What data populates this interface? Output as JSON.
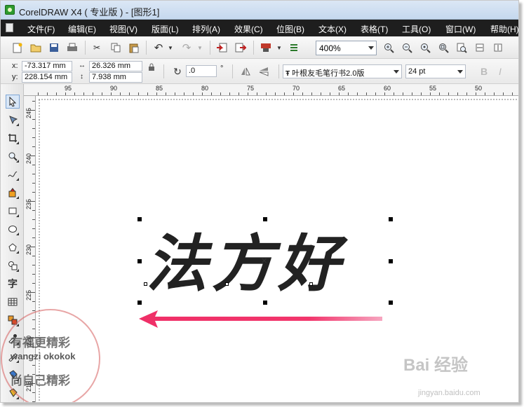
{
  "window": {
    "title": "CorelDRAW X4 ( 专业版 ) - [图形1]"
  },
  "menu": [
    "文件(F)",
    "编辑(E)",
    "视图(V)",
    "版面(L)",
    "排列(A)",
    "效果(C)",
    "位图(B)",
    "文本(X)",
    "表格(T)",
    "工具(O)",
    "窗口(W)",
    "帮助(H)"
  ],
  "toolbar": {
    "zoom_value": "400%",
    "icons": [
      "new-icon",
      "open-icon",
      "save-icon",
      "print-icon",
      "cut-icon",
      "copy-icon",
      "paste-icon",
      "undo-icon",
      "redo-icon",
      "import-icon",
      "export-icon",
      "application-launcher-icon",
      "welcome-screen-icon",
      "zoom-in-icon",
      "zoom-out-icon",
      "zoom-selected-icon",
      "zoom-all-icon",
      "zoom-page-icon",
      "zoom-width-icon",
      "zoom-height-icon"
    ]
  },
  "property_bar": {
    "x_label": "x:",
    "x_value": "-73.317 mm",
    "y_label": "y:",
    "y_value": "228.154 mm",
    "width_value": "26.326 mm",
    "height_value": "7.938 mm",
    "rotation_value": ".0",
    "degree_symbol": "°",
    "font_name": "叶根友毛笔行书2.0版",
    "font_size": "24 pt",
    "bold_label": "B",
    "italic_label": "I"
  },
  "ruler": {
    "horizontal_labels": [
      "95",
      "90",
      "85",
      "80",
      "75",
      "70",
      "65",
      "60",
      "55",
      "50"
    ],
    "vertical_labels": [
      "245",
      "240",
      "235",
      "230",
      "225",
      "220",
      "215"
    ]
  },
  "toolbox": {
    "tools": [
      "pick-tool",
      "shape-tool",
      "crop-tool",
      "zoom-tool",
      "freehand-tool",
      "smart-fill-tool",
      "rectangle-tool",
      "ellipse-tool",
      "polygon-tool",
      "basic-shapes-tool",
      "text-tool",
      "table-tool",
      "interactive-blend-tool",
      "eyedropper-tool",
      "outline-tool",
      "fill-tool",
      "interactive-fill-tool"
    ],
    "text_tool_glyph": "字"
  },
  "canvas": {
    "text": "法方好",
    "arrow_color": "#ef2f67"
  },
  "watermark": {
    "stamp_line1": "有福更精彩",
    "stamp_line2": "wangzi okokok",
    "stamp_line3": "尚自己精彩",
    "baidu_logo": "Bai 经验",
    "baidu_url": "jingyan.baidu.com"
  }
}
